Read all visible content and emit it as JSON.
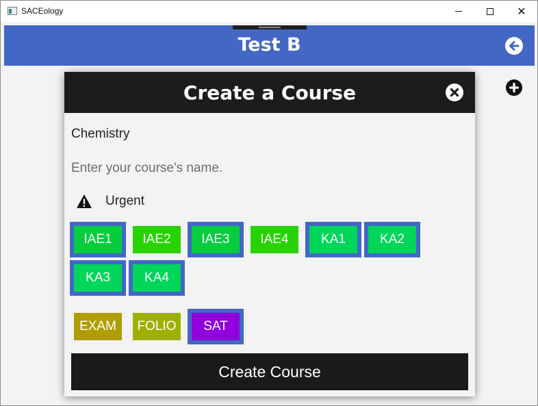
{
  "window": {
    "title": "SACEology",
    "controls": {
      "minimize": "minimize",
      "maximize": "maximize",
      "close": "✕"
    }
  },
  "header": {
    "title": "Test B",
    "back_icon": "arrow-left-circle-icon",
    "accent_color": "#4267c5"
  },
  "add_icon": "plus-circle-icon",
  "dialog": {
    "title": "Create a Course",
    "close_icon": "close-circle-icon",
    "course_name_value": "Chemistry",
    "course_name_placeholder": "Enter your course's name.",
    "urgent_label": "Urgent",
    "urgent_icon": "warning-icon",
    "assessment_tags": [
      {
        "label": "IAE1",
        "selected": true,
        "color": "#06cd3e"
      },
      {
        "label": "IAE2",
        "selected": false,
        "color": "#28d304"
      },
      {
        "label": "IAE3",
        "selected": true,
        "color": "#06cd3e"
      },
      {
        "label": "IAE4",
        "selected": false,
        "color": "#28d304"
      },
      {
        "label": "KA1",
        "selected": true,
        "color": "#00d65a"
      },
      {
        "label": "KA2",
        "selected": true,
        "color": "#00d65a"
      },
      {
        "label": "KA3",
        "selected": true,
        "color": "#00d65a"
      },
      {
        "label": "KA4",
        "selected": true,
        "color": "#00d65a"
      }
    ],
    "type_tags": [
      {
        "label": "EXAM",
        "selected": false,
        "color": "#b09d04"
      },
      {
        "label": "FOLIO",
        "selected": false,
        "color": "#9fb002"
      },
      {
        "label": "SAT",
        "selected": true,
        "color": "#8f00dc"
      }
    ],
    "submit_label": "Create Course"
  }
}
